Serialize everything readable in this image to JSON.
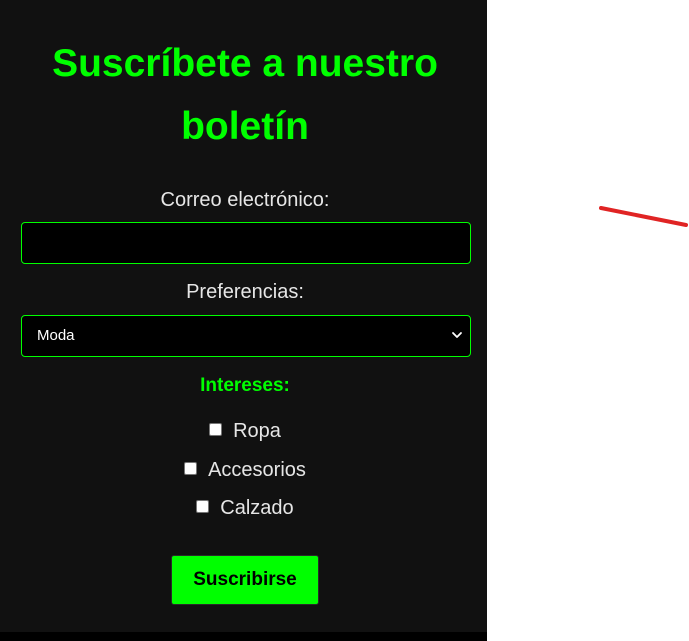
{
  "form": {
    "title": "Suscríbete a nuestro boletín",
    "email_label": "Correo electrónico:",
    "email_value": "",
    "preferences_label": "Preferencias:",
    "preferences_selected": "Moda",
    "interests_label": "Intereses:",
    "interests": [
      {
        "label": "Ropa",
        "checked": false
      },
      {
        "label": "Accesorios",
        "checked": false
      },
      {
        "label": "Calzado",
        "checked": false
      }
    ],
    "submit_label": "Suscribirse"
  },
  "colors": {
    "panel_background": "#111111",
    "accent": "#00ff00",
    "page_background": "#ffffff",
    "stroke": "#e02424"
  },
  "icons": {
    "select_chevron": "chevron-down-icon"
  }
}
